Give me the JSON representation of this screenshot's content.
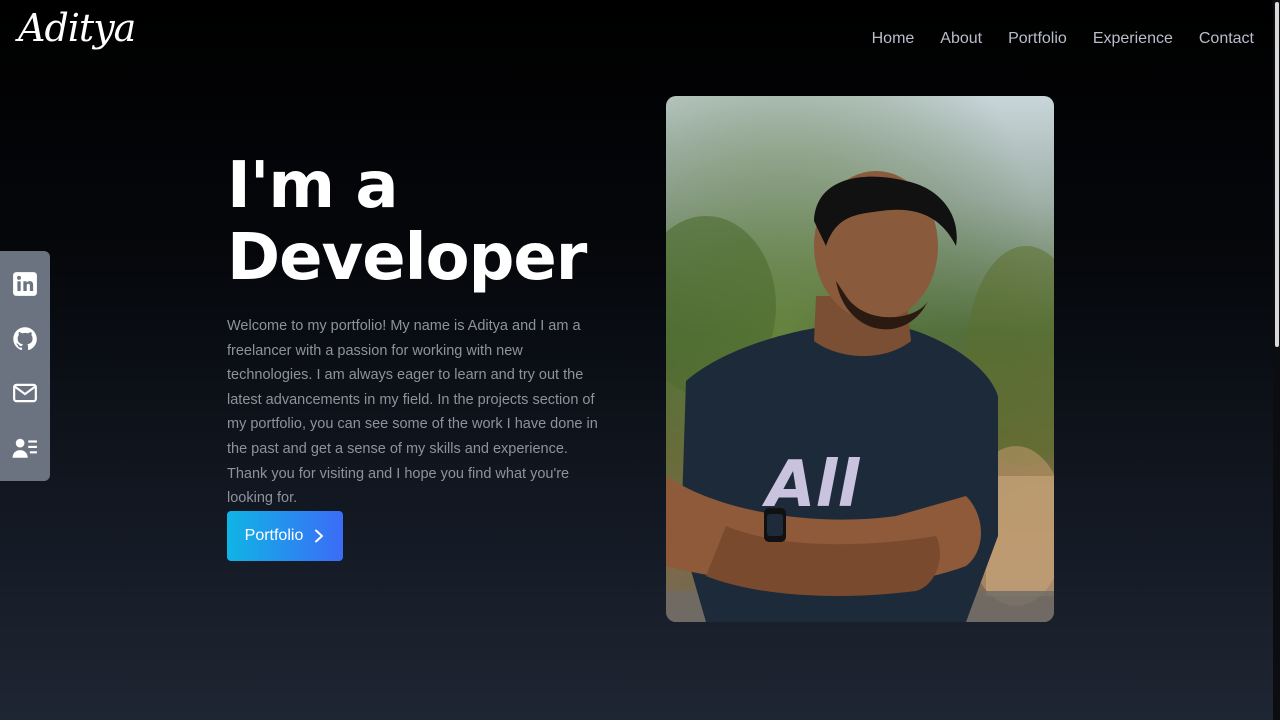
{
  "header": {
    "logo": "Aditya",
    "nav": [
      "Home",
      "About",
      "Portfolio",
      "Experience",
      "Contact"
    ]
  },
  "social": {
    "icons": [
      "linkedin-icon",
      "github-icon",
      "mail-icon",
      "resume-icon"
    ],
    "color": "#6b7280"
  },
  "hero": {
    "headline_line1": "I'm a",
    "headline_line2": "Developer",
    "intro": "Welcome to my portfolio! My name is Aditya and I am a freelancer with a passion for working with new technologies. I am always eager to learn and try out the latest advancements in my field. In the projects section of my portfolio, you can see some of the work I have done in the past and get a sense of my skills and experience. Thank you for visiting and I hope you find what you're looking for.",
    "cta_label": "Portfolio",
    "cta_icon": "chevron-right-icon",
    "accent_gradient": [
      "#10b4e6",
      "#3b6cf6"
    ]
  },
  "photo": {
    "shirt_text": "All"
  }
}
